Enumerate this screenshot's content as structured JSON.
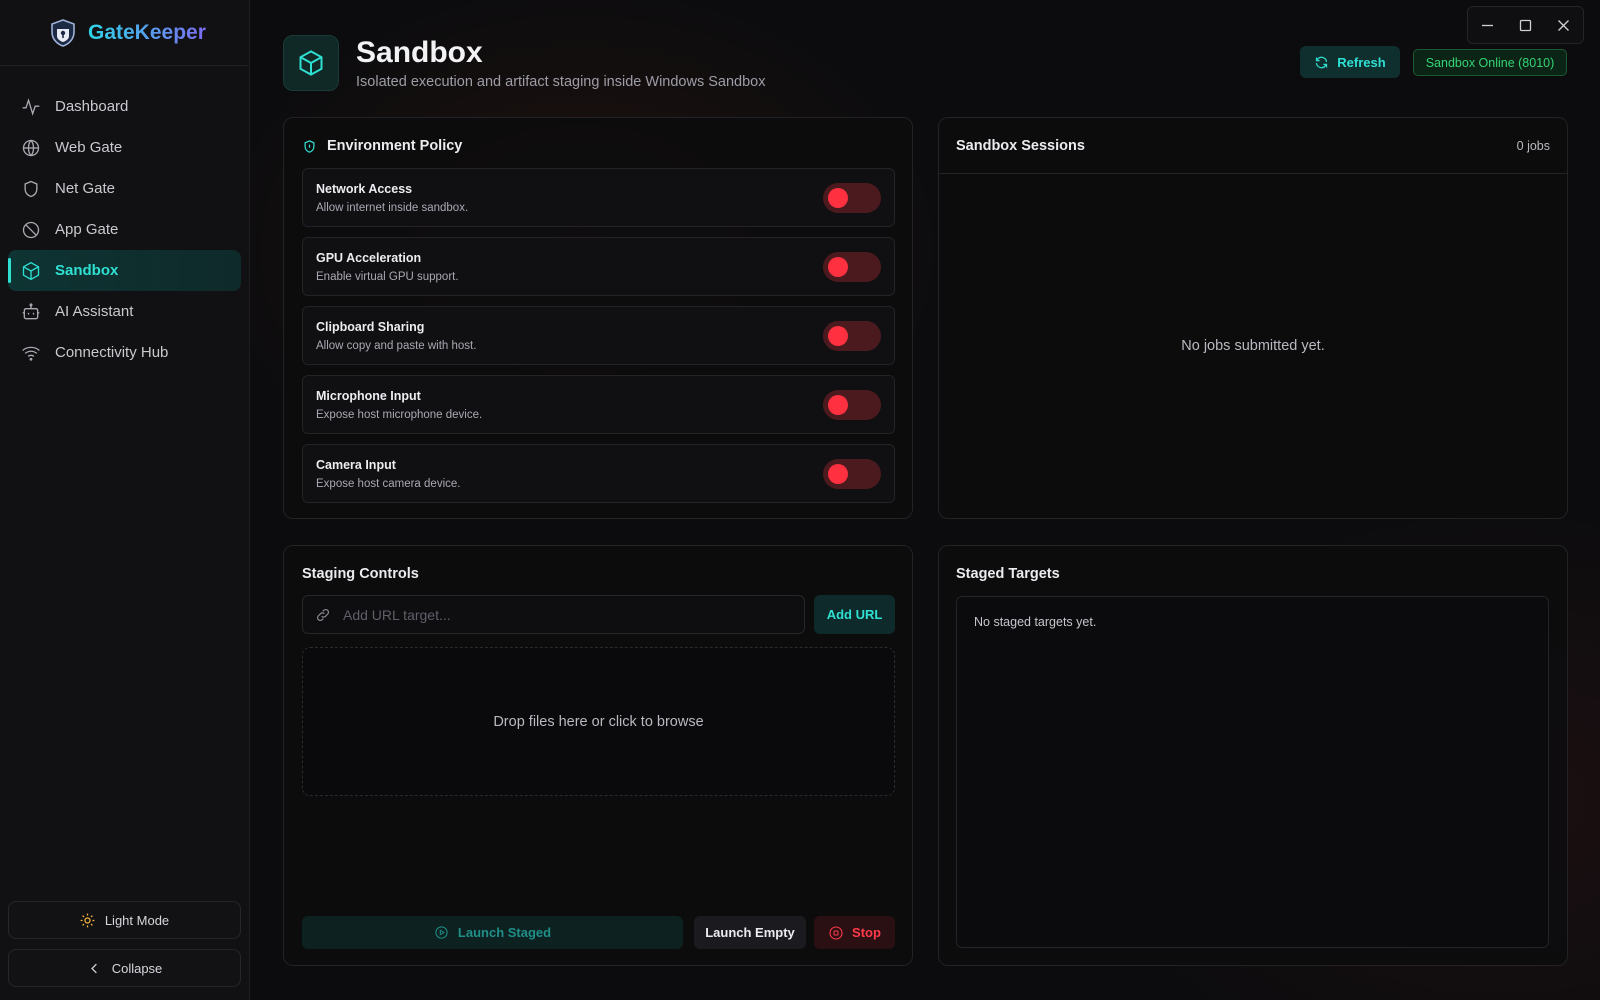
{
  "app": {
    "name": "GateKeeper"
  },
  "sidebar": {
    "items": [
      {
        "label": "Dashboard",
        "icon": "activity-icon",
        "active": false
      },
      {
        "label": "Web Gate",
        "icon": "globe-icon",
        "active": false
      },
      {
        "label": "Net Gate",
        "icon": "shield-icon",
        "active": false
      },
      {
        "label": "App Gate",
        "icon": "ban-icon",
        "active": false
      },
      {
        "label": "Sandbox",
        "icon": "cube-icon",
        "active": true
      },
      {
        "label": "AI Assistant",
        "icon": "bot-icon",
        "active": false
      },
      {
        "label": "Connectivity Hub",
        "icon": "wifi-icon",
        "active": false
      }
    ],
    "theme_toggle_label": "Light Mode",
    "collapse_label": "Collapse"
  },
  "header": {
    "title": "Sandbox",
    "subtitle": "Isolated execution and artifact staging inside Windows Sandbox",
    "refresh_label": "Refresh",
    "status_label": "Sandbox Online (8010)"
  },
  "policy": {
    "title": "Environment Policy",
    "items": [
      {
        "label": "Network Access",
        "description": "Allow internet inside sandbox.",
        "enabled": false
      },
      {
        "label": "GPU Acceleration",
        "description": "Enable virtual GPU support.",
        "enabled": false
      },
      {
        "label": "Clipboard Sharing",
        "description": "Allow copy and paste with host.",
        "enabled": false
      },
      {
        "label": "Microphone Input",
        "description": "Expose host microphone device.",
        "enabled": false
      },
      {
        "label": "Camera Input",
        "description": "Expose host camera device.",
        "enabled": false
      }
    ]
  },
  "sessions": {
    "title": "Sandbox Sessions",
    "count_label": "0 jobs",
    "empty_text": "No jobs submitted yet."
  },
  "staging": {
    "title": "Staging Controls",
    "url_placeholder": "Add URL target...",
    "url_value": "",
    "add_url_label": "Add URL",
    "dropzone_text": "Drop files here or click to browse",
    "launch_staged_label": "Launch Staged",
    "launch_empty_label": "Launch Empty",
    "stop_label": "Stop"
  },
  "targets": {
    "title": "Staged Targets",
    "empty_text": "No staged targets yet."
  },
  "colors": {
    "accent": "#2fe0d2",
    "danger": "#ff3040",
    "online": "#34d374",
    "background": "#0c0c0e"
  }
}
